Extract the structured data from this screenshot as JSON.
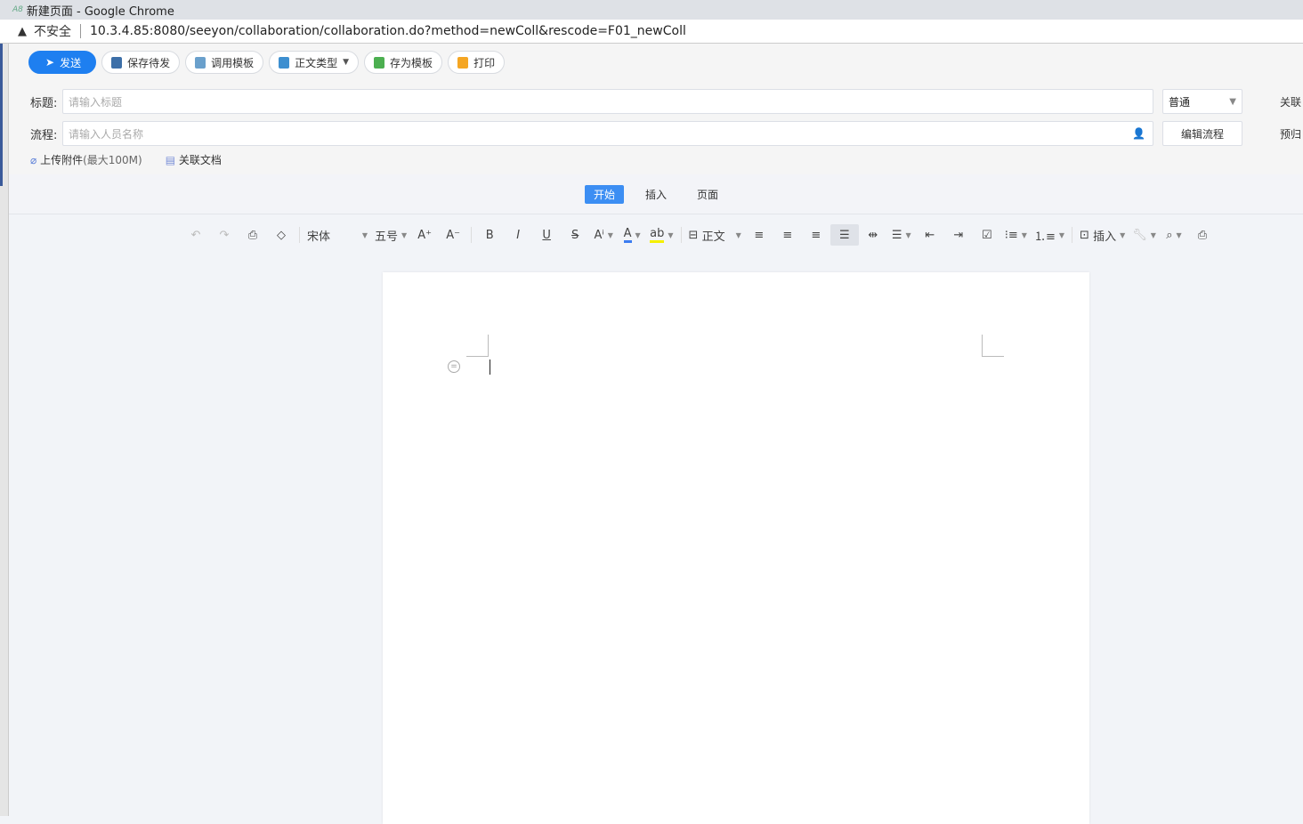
{
  "window": {
    "title": "新建页面 - Google Chrome",
    "security": "不安全",
    "url": "10.3.4.85:8080/seeyon/collaboration/collaboration.do?method=newColl&rescode=F01_newColl"
  },
  "actions": {
    "send": "发送",
    "save_draft": "保存待发",
    "use_template": "调用模板",
    "body_type": "正文类型",
    "save_template": "存为模板",
    "print": "打印"
  },
  "form": {
    "title_label": "标题:",
    "title_placeholder": "请输入标题",
    "flow_label": "流程:",
    "flow_placeholder": "请输入人员名称",
    "priority": "普通",
    "edit_flow": "编辑流程",
    "related_label": "关联",
    "archive_label": "预归",
    "upload": "上传附件",
    "upload_limit": "(最大100M)",
    "related_doc": "关联文档"
  },
  "editor": {
    "tabs": [
      "开始",
      "插入",
      "页面"
    ],
    "font": "宋体",
    "size": "五号",
    "style": "正文",
    "insert": "插入"
  },
  "colors": {
    "primary": "#1e7ff0",
    "tab_active": "#3c8ef3",
    "font_color": "#3c7cf0",
    "highlight": "#f5f000"
  }
}
